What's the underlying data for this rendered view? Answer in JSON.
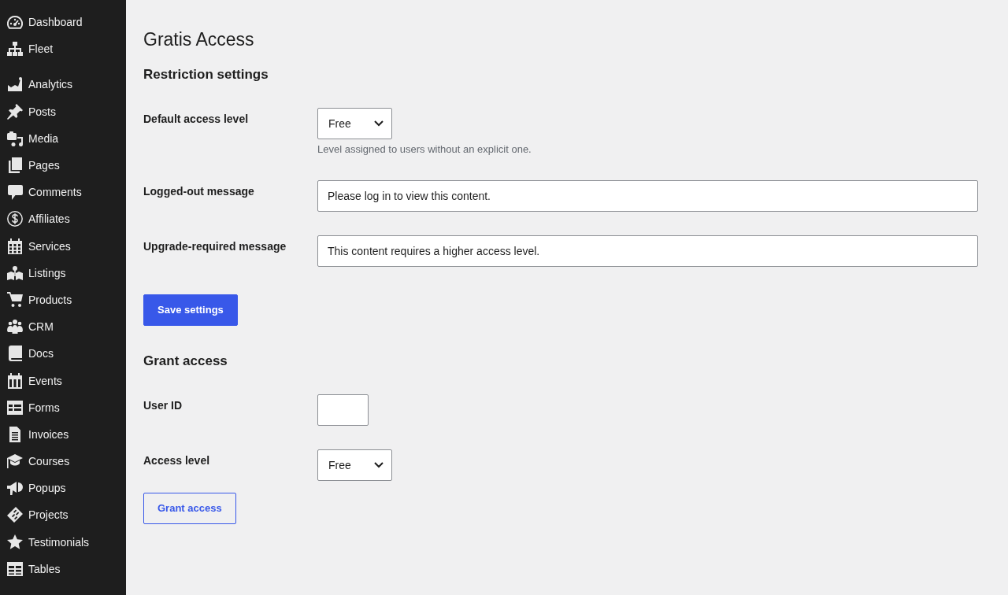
{
  "sidebar": {
    "sections": [
      {
        "items": [
          {
            "label": "Dashboard"
          },
          {
            "label": "Fleet"
          }
        ]
      },
      {
        "items": [
          {
            "label": "Analytics"
          },
          {
            "label": "Posts"
          },
          {
            "label": "Media"
          },
          {
            "label": "Pages"
          },
          {
            "label": "Comments"
          },
          {
            "label": "Affiliates"
          },
          {
            "label": "Services"
          },
          {
            "label": "Listings"
          },
          {
            "label": "Products"
          },
          {
            "label": "CRM"
          },
          {
            "label": "Docs"
          },
          {
            "label": "Events"
          },
          {
            "label": "Forms"
          },
          {
            "label": "Invoices"
          },
          {
            "label": "Courses"
          },
          {
            "label": "Popups"
          },
          {
            "label": "Projects"
          },
          {
            "label": "Testimonials"
          },
          {
            "label": "Tables"
          }
        ]
      }
    ]
  },
  "page": {
    "title": "Gratis Access"
  },
  "sections": [
    {
      "heading": "Restriction settings",
      "fields": [
        {
          "kind": "select",
          "label": "Default access level",
          "value": "Free",
          "description": "Level assigned to users without an explicit one."
        },
        {
          "kind": "text",
          "label": "Logged-out message",
          "value": "Please log in to view this content."
        },
        {
          "kind": "text",
          "label": "Upgrade-required message",
          "value": "This content requires a higher access level."
        }
      ],
      "button": {
        "kind": "primary",
        "label": "Save settings"
      }
    },
    {
      "heading": "Grant access",
      "fields": [
        {
          "kind": "number",
          "label": "User ID"
        },
        {
          "kind": "select",
          "label": "Access level",
          "value": "Free"
        }
      ],
      "button": {
        "kind": "secondary",
        "label": "Grant access"
      }
    }
  ]
}
